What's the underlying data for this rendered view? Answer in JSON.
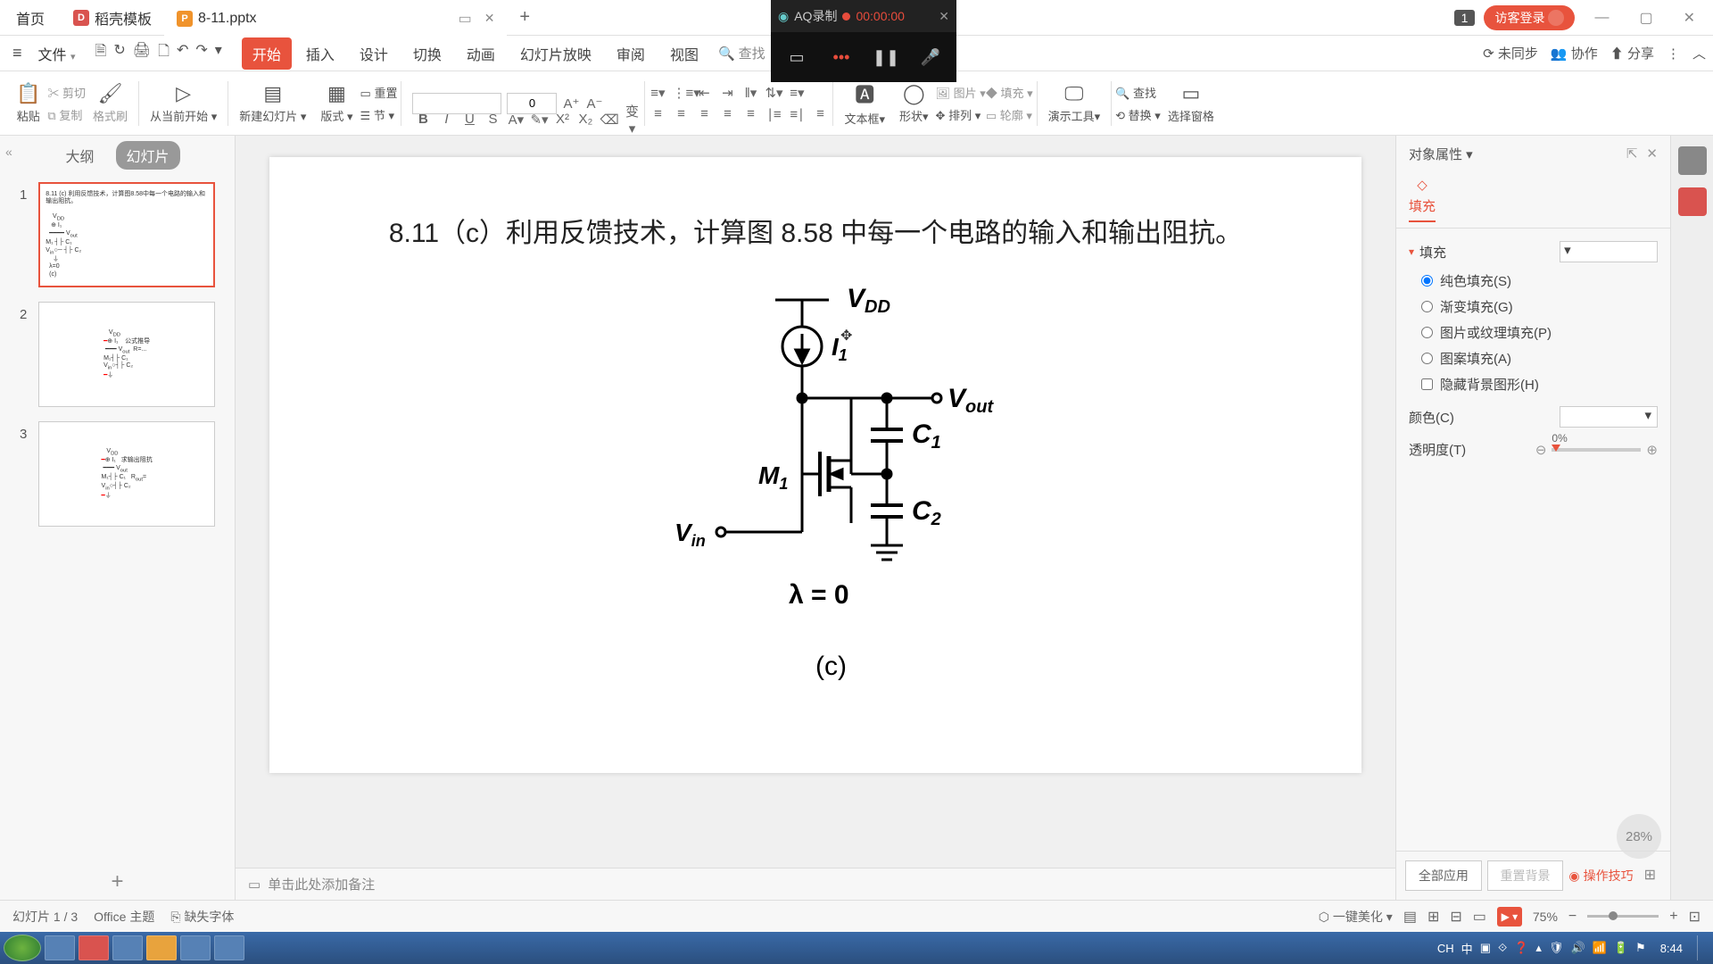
{
  "titlebar": {
    "home": "首页",
    "doc1": "稻壳模板",
    "doc2": "8-11.pptx",
    "badge": "1",
    "login": "访客登录"
  },
  "recording": {
    "title": "AQ录制",
    "time": "00:00:00"
  },
  "menubar": {
    "file": "文件",
    "tabs": [
      "开始",
      "插入",
      "设计",
      "切换",
      "动画",
      "幻灯片放映",
      "审阅",
      "视图"
    ],
    "search": "查找",
    "right": {
      "unsync": "未同步",
      "collab": "协作",
      "share": "分享"
    }
  },
  "ribbon": {
    "paste": "粘贴",
    "cut": "剪切",
    "copy": "复制",
    "format": "格式刷",
    "play": "从当前开始",
    "newslide": "新建幻灯片",
    "layout": "版式",
    "section": "节",
    "reset": "重置",
    "font_size": "0",
    "textbox": "文本框",
    "shape": "形状",
    "arrange": "排列",
    "image": "图片",
    "fill": "填充",
    "contour": "轮廓",
    "tools": "演示工具",
    "find": "查找",
    "replace": "替换",
    "select": "选择窗格"
  },
  "sidebar": {
    "tab_outline": "大纲",
    "tab_slides": "幻灯片",
    "nums": [
      "1",
      "2",
      "3"
    ]
  },
  "slide": {
    "title": "8.11（c）利用反馈技术，计算图 8.58 中每一个电路的输入和输出阻抗。",
    "vdd": "V",
    "vdd_sub": "DD",
    "i1": "I",
    "i1_sub": "1",
    "vout": "V",
    "vout_sub": "out",
    "c1": "C",
    "c1_sub": "1",
    "c2": "C",
    "c2_sub": "2",
    "m1": "M",
    "m1_sub": "1",
    "vin": "V",
    "vin_sub": "in",
    "lambda": "λ = 0",
    "label_c": "(c)",
    "notes": "单击此处添加备注"
  },
  "rpanel": {
    "head": "对象属性",
    "tab_fill": "填充",
    "section_fill": "填充",
    "r_solid": "纯色填充(S)",
    "r_gradient": "渐变填充(G)",
    "r_pic": "图片或纹理填充(P)",
    "r_pattern": "图案填充(A)",
    "chk_hide": "隐藏背景图形(H)",
    "lbl_color": "颜色(C)",
    "lbl_trans": "透明度(T)",
    "trans_val": "0%",
    "btn_all": "全部应用",
    "btn_bg": "重置背景",
    "btn_tips": "操作技巧"
  },
  "status": {
    "slide": "幻灯片 1 / 3",
    "theme": "Office 主题",
    "missing": "缺失字体",
    "beautify": "一键美化",
    "zoom": "75%",
    "float_badge": "28%"
  },
  "taskbar": {
    "lang": "CH",
    "ime": "中",
    "time": "8:44"
  }
}
